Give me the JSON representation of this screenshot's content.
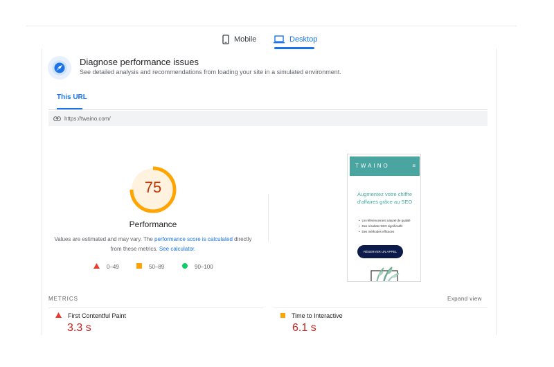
{
  "device_tabs": {
    "mobile_label": "Mobile",
    "desktop_label": "Desktop",
    "active": "desktop"
  },
  "diagnose": {
    "title": "Diagnose performance issues",
    "subtitle": "See detailed analysis and recommendations from loading your site in a simulated environment."
  },
  "url_tab": {
    "label": "This URL",
    "url": "https://twaino.com/"
  },
  "performance": {
    "score": "75",
    "score_fraction": 0.75,
    "label": "Performance",
    "note_prefix": "Values are estimated and may vary. The ",
    "note_link1": "performance score is calculated",
    "note_middle": " directly from these metrics. ",
    "note_link2": "See calculator.",
    "legend": {
      "fail": "0–49",
      "average": "50–89",
      "pass": "90–100"
    }
  },
  "screenshot": {
    "logo": "TWAINO",
    "menu_glyph": "≡",
    "heading": "Augmentez votre chiffre d'affaires grâce au SEO",
    "bullets": [
      "Un référencement naturel de qualité",
      "Des résultats SEO significatifs",
      "Des méthodes efficaces"
    ],
    "button": "RÉSERVER UN APPEL"
  },
  "metrics": {
    "title": "METRICS",
    "expand": "Expand view",
    "items": [
      {
        "name": "First Contentful Paint",
        "value": "3.3 s",
        "rating": "fail"
      },
      {
        "name": "Time to Interactive",
        "value": "6.1 s",
        "rating": "average"
      }
    ]
  },
  "colors": {
    "accent": "#1a73e8",
    "fail": "#eb3b2c",
    "average": "#ffa400",
    "pass": "#0cce6b",
    "fail_text": "#c5221f",
    "gauge_score_text": "#c33300",
    "gauge_fill": "#fff3e0",
    "brand_teal": "#4aa5a0"
  }
}
